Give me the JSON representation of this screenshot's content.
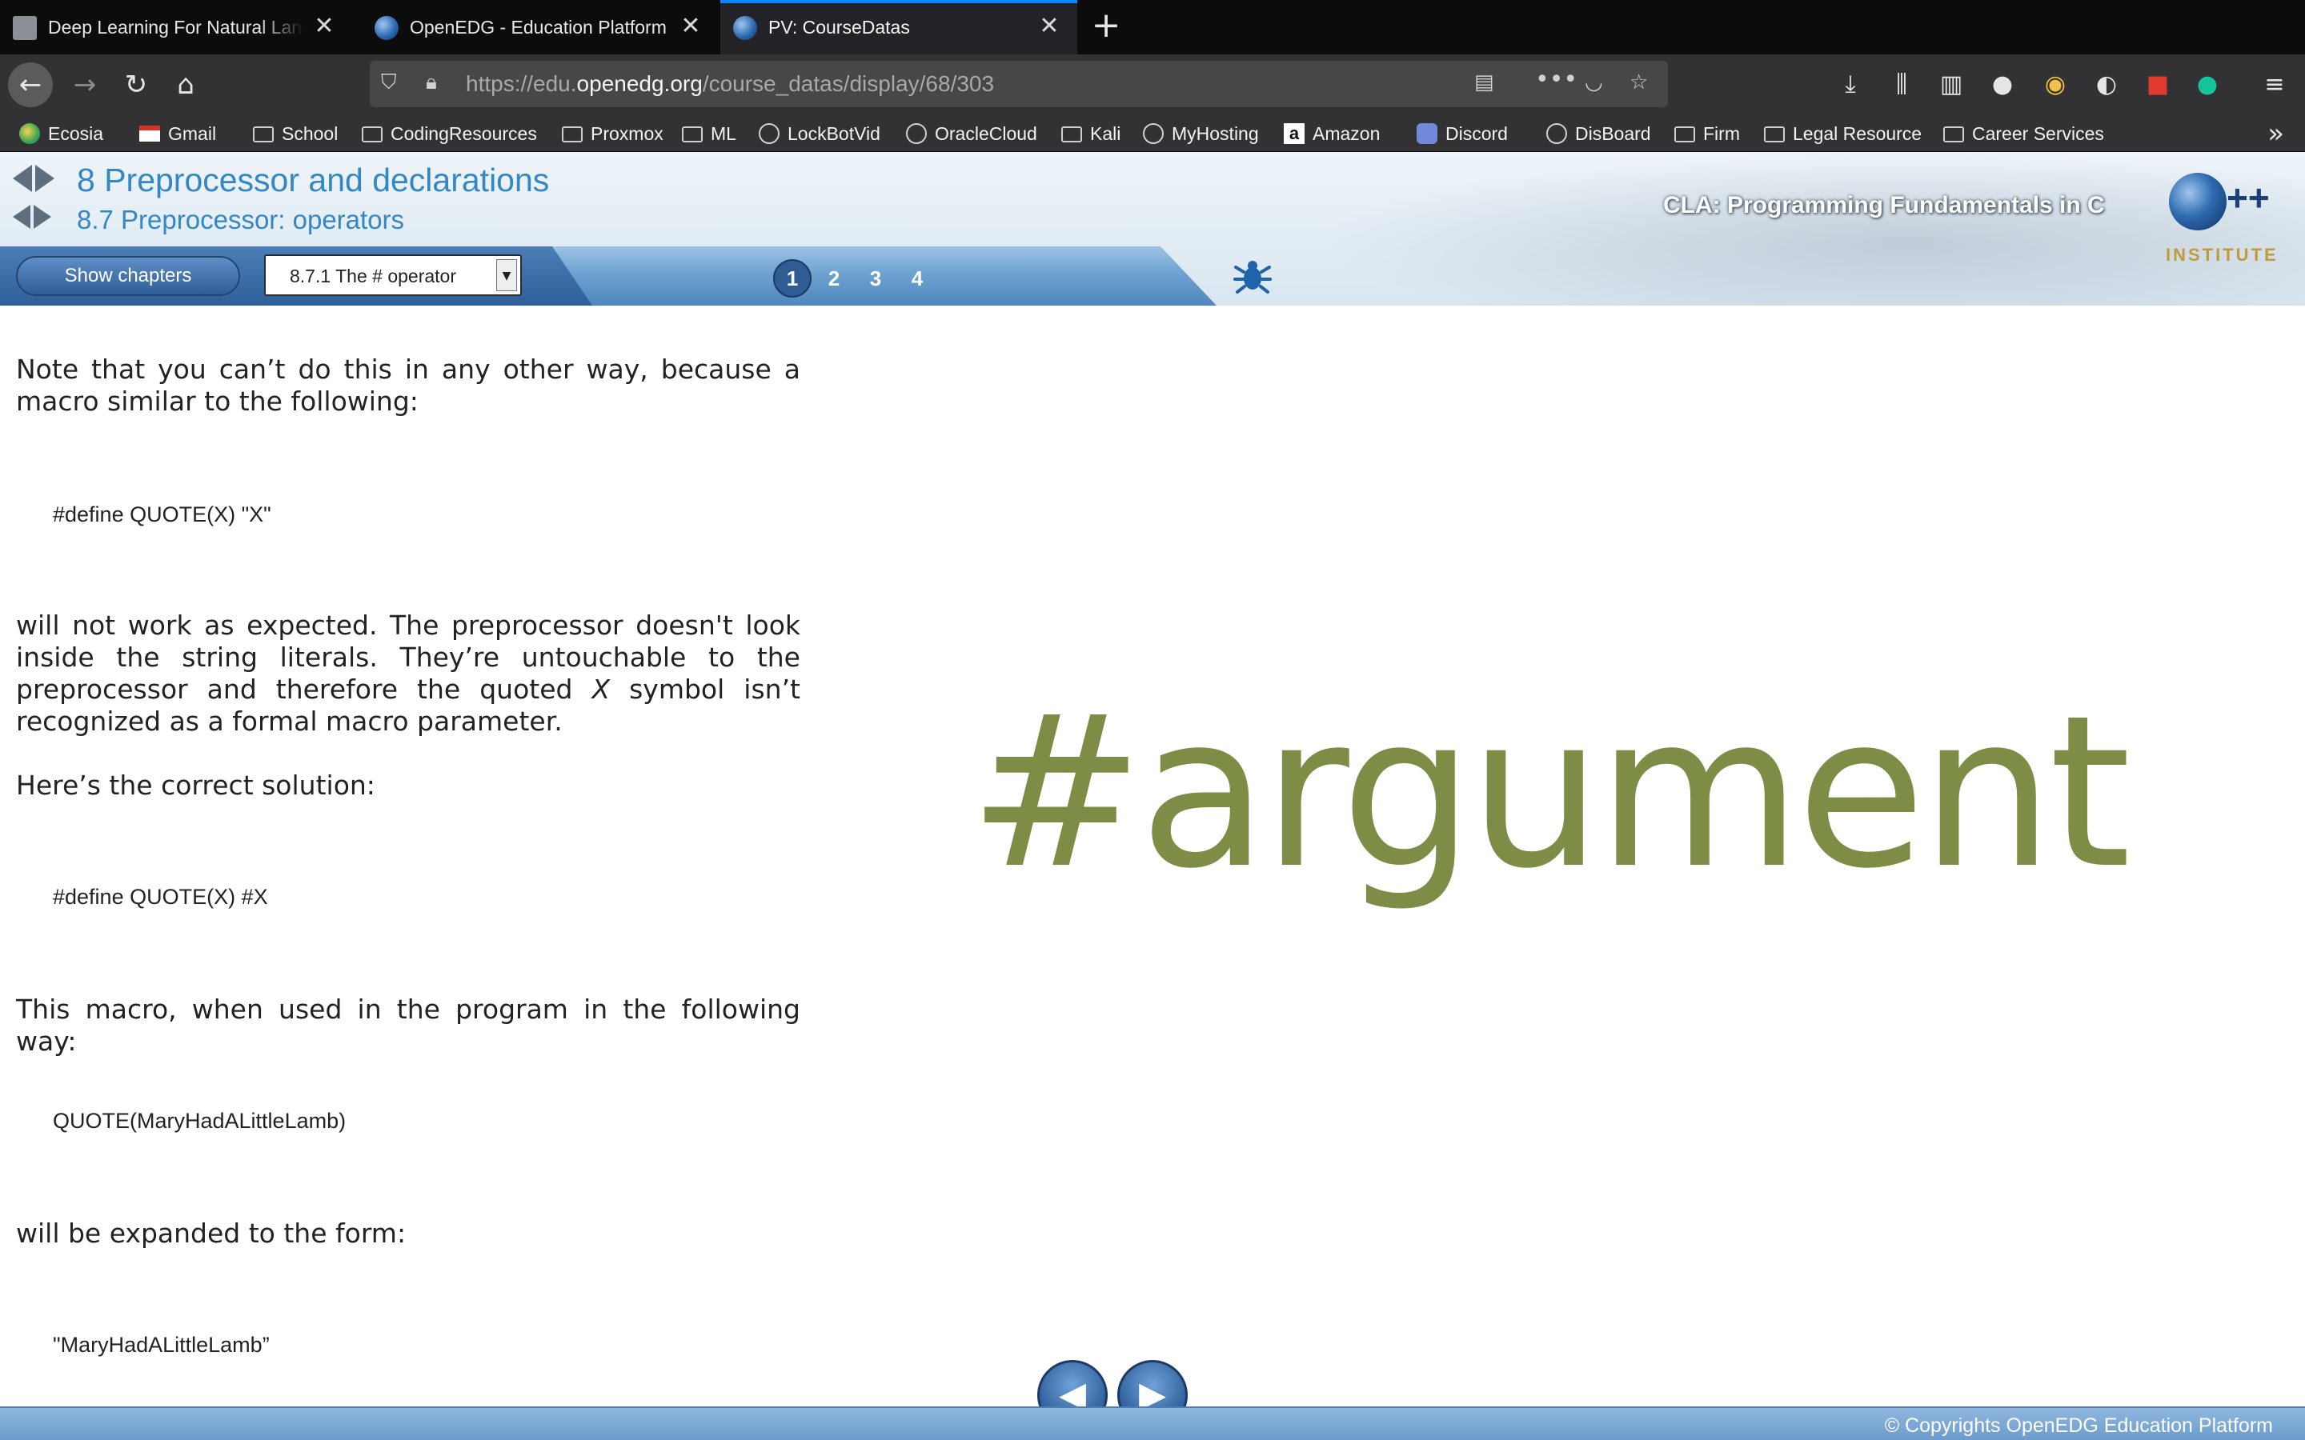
{
  "browser": {
    "tabs": [
      {
        "title": "Deep Learning For Natural Language Processing",
        "icon": "document-thumbnail-icon"
      },
      {
        "title": "OpenEDG - Education Platform",
        "icon": "openedg-globe-icon"
      },
      {
        "title": "PV: CourseDatas",
        "icon": "openedg-globe-icon",
        "active": true
      }
    ],
    "new_tab_label": "+",
    "url_scheme": "https://edu.",
    "url_domain": "openedg.org",
    "url_path": "/course_datas/display/68/303",
    "bookmarks": [
      {
        "label": "Ecosia",
        "icon": "ecosia-icon"
      },
      {
        "label": "Gmail",
        "icon": "gmail-icon"
      },
      {
        "label": "School",
        "icon": "folder-icon"
      },
      {
        "label": "CodingResources",
        "icon": "folder-icon"
      },
      {
        "label": "Proxmox",
        "icon": "folder-icon"
      },
      {
        "label": "ML",
        "icon": "folder-icon"
      },
      {
        "label": "LockBotVid",
        "icon": "globe-icon"
      },
      {
        "label": "OracleCloud",
        "icon": "globe-icon"
      },
      {
        "label": "Kali",
        "icon": "folder-icon"
      },
      {
        "label": "MyHosting",
        "icon": "globe-icon"
      },
      {
        "label": "Amazon",
        "icon": "amazon-icon"
      },
      {
        "label": "Discord",
        "icon": "discord-icon"
      },
      {
        "label": "DisBoard",
        "icon": "globe-icon"
      },
      {
        "label": "Firm",
        "icon": "folder-icon"
      },
      {
        "label": "Legal Resource",
        "icon": "folder-icon"
      },
      {
        "label": "Career Services",
        "icon": "folder-icon"
      }
    ]
  },
  "course": {
    "chapter_title": "8 Preprocessor and declarations",
    "section_title": "8.7 Preprocessor: operators",
    "course_name": "CLA: Programming Fundamentals in C",
    "logo_text": "++",
    "logo_sub": "INSTITUTE",
    "show_chapters_label": "Show chapters",
    "selected_section": "8.7.1 The # operator",
    "pages": [
      "1",
      "2",
      "3",
      "4"
    ],
    "active_page": "1"
  },
  "content": {
    "p1": "Note that you can’t do this in any other way, because a macro similar to the following:",
    "code1": "#define QUOTE(X) \"X\"",
    "p2_a": "will not work as expected. The preprocessor doesn't look inside the string literals. They’re untouchable to the preprocessor and therefore the quoted ",
    "p2_x": "X",
    "p2_b": " symbol isn’t recognized as a formal macro parameter.",
    "p3": "Here’s the correct solution:",
    "code2": "#define QUOTE(X) #X",
    "p4": "This macro, when used in the program in the following way:",
    "code3": "QUOTE(MaryHadALittleLamb)",
    "p5": "will be expanded to the form:",
    "code4": "\"MaryHadALittleLamb”",
    "big_image_text": "#argument"
  },
  "footer": {
    "copyright": "© Copyrights OpenEDG Education Platform"
  },
  "colors": {
    "title_blue": "#3387c4",
    "olive": "#7e8d46",
    "tab_accent": "#0a84ff"
  }
}
